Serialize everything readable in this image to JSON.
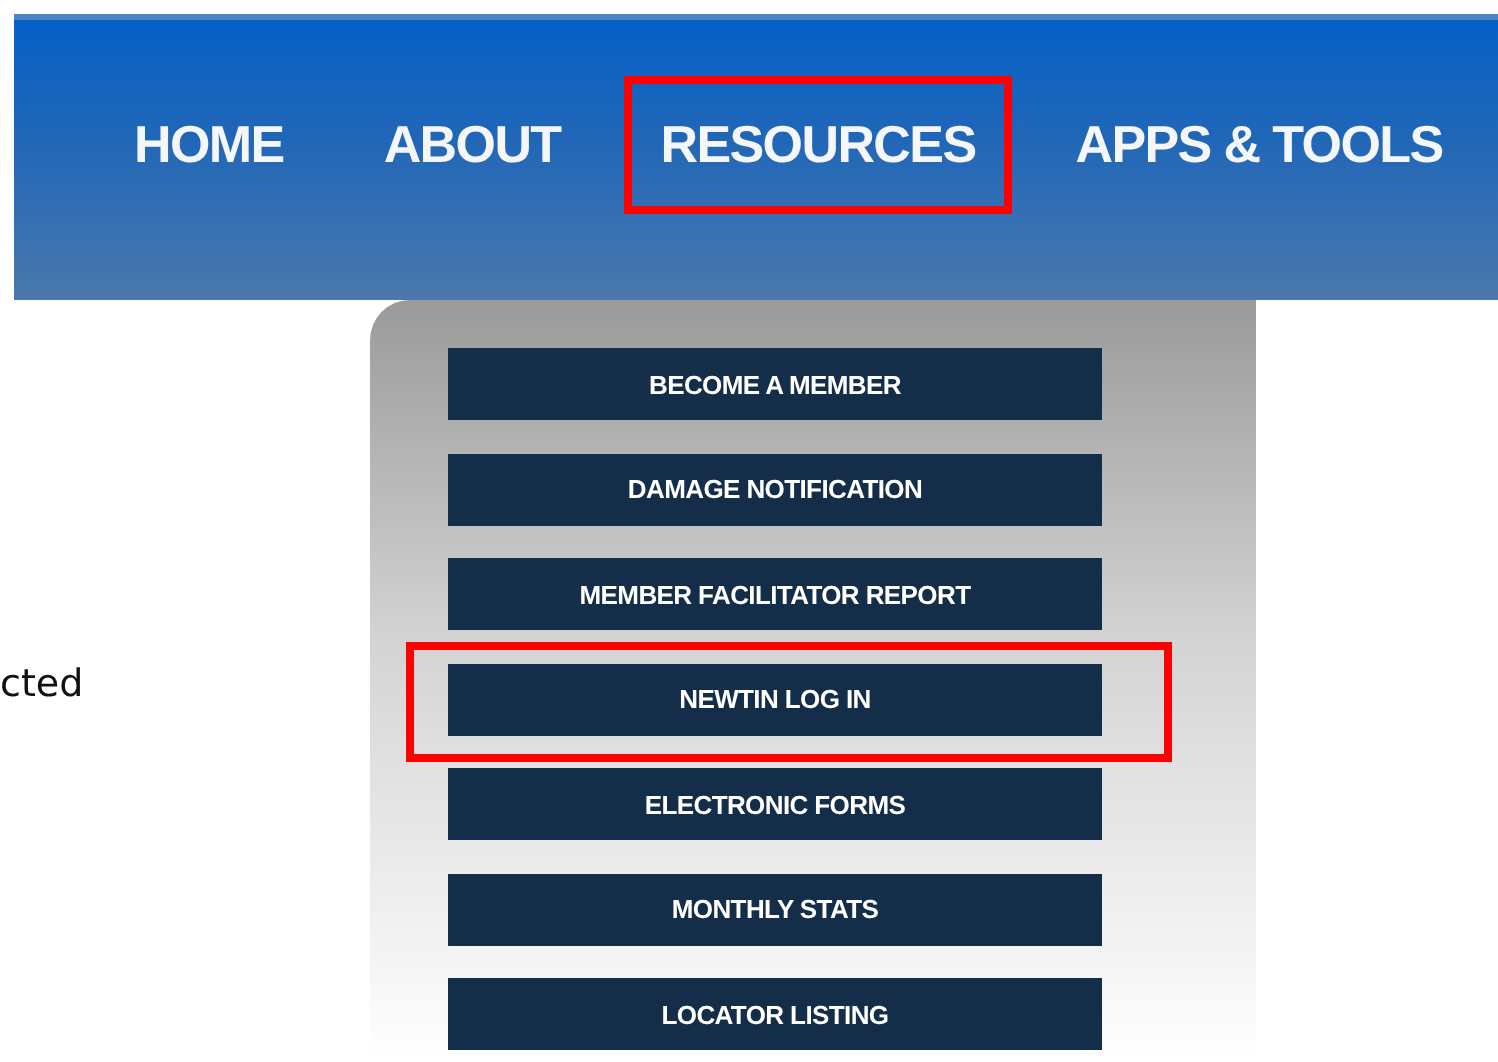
{
  "nav": {
    "items": [
      {
        "label": "HOME",
        "highlighted": false
      },
      {
        "label": "ABOUT",
        "highlighted": false
      },
      {
        "label": "RESOURCES",
        "highlighted": true
      },
      {
        "label": "APPS & TOOLS",
        "highlighted": false
      }
    ]
  },
  "side_text": "cted",
  "dropdown": {
    "items": [
      {
        "label": "BECOME A MEMBER",
        "highlighted": false
      },
      {
        "label": "DAMAGE NOTIFICATION",
        "highlighted": false
      },
      {
        "label": "MEMBER FACILITATOR REPORT",
        "highlighted": false
      },
      {
        "label": "NEWTIN LOG IN",
        "highlighted": true
      },
      {
        "label": "ELECTRONIC FORMS",
        "highlighted": false
      },
      {
        "label": "MONTHLY STATS",
        "highlighted": false
      },
      {
        "label": "LOCATOR LISTING",
        "highlighted": false
      }
    ]
  }
}
